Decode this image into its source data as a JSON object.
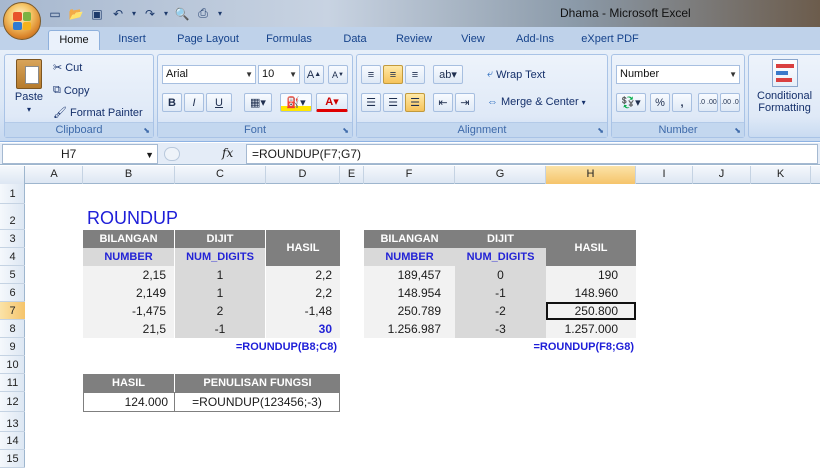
{
  "window": {
    "title": "Dhama - Microsoft Excel"
  },
  "qat": {
    "icons": [
      "new-icon",
      "open-icon",
      "save-icon",
      "undo-icon",
      "redo-icon",
      "print-preview-icon",
      "quick-print-icon"
    ]
  },
  "tabs": [
    "Home",
    "Insert",
    "Page Layout",
    "Formulas",
    "Data",
    "Review",
    "View",
    "Add-Ins",
    "eXpert PDF"
  ],
  "ribbon": {
    "clipboard": {
      "label": "Clipboard",
      "paste": "Paste",
      "cut": "Cut",
      "copy": "Copy",
      "format_painter": "Format Painter"
    },
    "font": {
      "label": "Font",
      "family": "Arial",
      "size": "10",
      "bold": "B",
      "italic": "I",
      "underline": "U"
    },
    "alignment": {
      "label": "Alignment",
      "wrap_text": "Wrap Text",
      "merge_center": "Merge & Center"
    },
    "number": {
      "label": "Number",
      "format": "Number",
      "percent": "%",
      "comma": ",",
      "inc_decimal": ".0 .00",
      "dec_decimal": ".00 .0"
    },
    "styles": {
      "conditional_line1": "Conditional",
      "conditional_line2": "Formatting"
    }
  },
  "formula_bar": {
    "name_box": "H7",
    "fx": "fx",
    "formula": "=ROUNDUP(F7;G7)"
  },
  "columns": [
    "A",
    "B",
    "C",
    "D",
    "E",
    "F",
    "G",
    "H",
    "I",
    "J",
    "K"
  ],
  "rows": [
    "1",
    "2",
    "3",
    "4",
    "5",
    "6",
    "7",
    "8",
    "9",
    "10",
    "11",
    "12",
    "13",
    "14",
    "15"
  ],
  "sheet": {
    "title": "ROUNDUP",
    "table1": {
      "h_bilangan": "BILANGAN",
      "h_digit": "DIJIT",
      "h_hasil": "HASIL",
      "h_number": "NUMBER",
      "h_num_digits": "NUM_DIGITS",
      "rows": [
        {
          "number": "2,15",
          "digits": "1",
          "result": "2,2"
        },
        {
          "number": "2,149",
          "digits": "1",
          "result": "2,2"
        },
        {
          "number": "-1,475",
          "digits": "2",
          "result": "-1,48"
        },
        {
          "number": "21,5",
          "digits": "-1",
          "result": "30"
        }
      ],
      "note": "=ROUNDUP(B8;C8)"
    },
    "table2": {
      "h_bilangan": "BILANGAN",
      "h_digit": "DIJIT",
      "h_hasil": "HASIL",
      "h_number": "NUMBER",
      "h_num_digits": "NUM_DIGITS",
      "rows": [
        {
          "number": "189,457",
          "digits": "0",
          "result": "190"
        },
        {
          "number": "148.954",
          "digits": "-1",
          "result": "148.960"
        },
        {
          "number": "250.789",
          "digits": "-2",
          "result": "250.800"
        },
        {
          "number": "1.256.987",
          "digits": "-3",
          "result": "1.257.000"
        }
      ],
      "note": "=ROUNDUP(F8;G8)"
    },
    "table3": {
      "h_hasil": "HASIL",
      "h_penulisan": "PENULISAN FUNGSI",
      "value": "124.000",
      "formula": "=ROUNDUP(123456;-3)"
    }
  }
}
